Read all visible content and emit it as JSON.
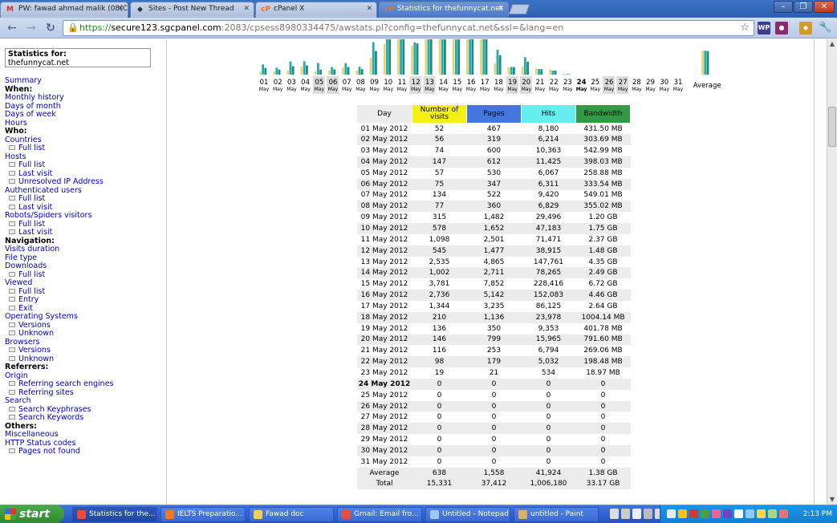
{
  "browser": {
    "tabs": [
      {
        "title": "PW: fawad ahmad malik (08(C",
        "icon": "gmail-icon",
        "color": "#d93025",
        "icon_text": "M"
      },
      {
        "title": "Sites - Post New Thread",
        "icon": "sites-icon",
        "color": "#333333",
        "icon_text": "◆"
      },
      {
        "title": "cPanel X",
        "icon": "cpanel-icon",
        "color": "#f26c1f",
        "icon_text": "cP"
      },
      {
        "title": "Statistics for thefunnycat.net",
        "icon": "cpanel-icon",
        "color": "#f26c1f",
        "icon_text": "cP",
        "active": true
      }
    ],
    "url": {
      "scheme": "https://",
      "host": "secure123.sgcpanel.com",
      "rest": ":2083/cpsess8980334475/awstats.pl?config=thefunnycat.net&ssl=&lang=en"
    },
    "accent": "#2f5fae"
  },
  "sidebar": {
    "stats_for_label": "Statistics for:",
    "site": "thefunnycat.net",
    "menu": [
      {
        "text": "Summary",
        "kind": "link"
      },
      {
        "text": "When:",
        "kind": "head"
      },
      {
        "text": "Monthly history",
        "kind": "link"
      },
      {
        "text": "Days of month",
        "kind": "link"
      },
      {
        "text": "Days of week",
        "kind": "link"
      },
      {
        "text": "Hours",
        "kind": "link"
      },
      {
        "text": "Who:",
        "kind": "head"
      },
      {
        "text": "Countries",
        "kind": "link"
      },
      {
        "text": "Full list",
        "kind": "sub"
      },
      {
        "text": "Hosts",
        "kind": "link"
      },
      {
        "text": "Full list",
        "kind": "sub"
      },
      {
        "text": "Last visit",
        "kind": "sub"
      },
      {
        "text": "Unresolved IP Address",
        "kind": "sub"
      },
      {
        "text": "Authenticated users",
        "kind": "link"
      },
      {
        "text": "Full list",
        "kind": "sub"
      },
      {
        "text": "Last visit",
        "kind": "sub"
      },
      {
        "text": "Robots/Spiders visitors",
        "kind": "link"
      },
      {
        "text": "Full list",
        "kind": "sub"
      },
      {
        "text": "Last visit",
        "kind": "sub"
      },
      {
        "text": "Navigation:",
        "kind": "head"
      },
      {
        "text": "Visits duration",
        "kind": "link"
      },
      {
        "text": "File type",
        "kind": "link"
      },
      {
        "text": "Downloads",
        "kind": "link"
      },
      {
        "text": "Full list",
        "kind": "sub"
      },
      {
        "text": "Viewed",
        "kind": "link"
      },
      {
        "text": "Full list",
        "kind": "sub"
      },
      {
        "text": "Entry",
        "kind": "sub"
      },
      {
        "text": "Exit",
        "kind": "sub"
      },
      {
        "text": "Operating Systems",
        "kind": "link"
      },
      {
        "text": "Versions",
        "kind": "sub"
      },
      {
        "text": "Unknown",
        "kind": "sub"
      },
      {
        "text": "Browsers",
        "kind": "link"
      },
      {
        "text": "Versions",
        "kind": "sub"
      },
      {
        "text": "Unknown",
        "kind": "sub"
      },
      {
        "text": "Referrers:",
        "kind": "head"
      },
      {
        "text": "Origin",
        "kind": "link"
      },
      {
        "text": "Referring search engines",
        "kind": "sub"
      },
      {
        "text": "Referring sites",
        "kind": "sub"
      },
      {
        "text": "Search",
        "kind": "link"
      },
      {
        "text": "Search Keyphrases",
        "kind": "sub"
      },
      {
        "text": "Search Keywords",
        "kind": "sub"
      },
      {
        "text": "Others:",
        "kind": "head"
      },
      {
        "text": "Miscellaneous",
        "kind": "link"
      },
      {
        "text": "HTTP Status codes",
        "kind": "link"
      },
      {
        "text": "Pages not found",
        "kind": "sub"
      }
    ]
  },
  "table": {
    "headers": {
      "day": "Day",
      "visits": "Number of visits",
      "pages": "Pages",
      "hits": "Hits",
      "bandwidth": "Bandwidth"
    },
    "header_colors": {
      "day": "#ececec",
      "visits": "#f5f116",
      "pages": "#4477dd",
      "hits": "#66eeee",
      "bandwidth": "#339944"
    },
    "rows": [
      [
        "01 May 2012",
        "52",
        "467",
        "8,180",
        "431.50 MB"
      ],
      [
        "02 May 2012",
        "56",
        "319",
        "6,214",
        "303.69 MB"
      ],
      [
        "03 May 2012",
        "74",
        "600",
        "10,363",
        "542.99 MB"
      ],
      [
        "04 May 2012",
        "147",
        "612",
        "11,425",
        "398.03 MB"
      ],
      [
        "05 May 2012",
        "57",
        "530",
        "6,067",
        "258.88 MB"
      ],
      [
        "06 May 2012",
        "75",
        "347",
        "6,311",
        "333.54 MB"
      ],
      [
        "07 May 2012",
        "134",
        "522",
        "9,420",
        "549.01 MB"
      ],
      [
        "08 May 2012",
        "77",
        "360",
        "6,829",
        "355.02 MB"
      ],
      [
        "09 May 2012",
        "315",
        "1,482",
        "29,496",
        "1.20 GB"
      ],
      [
        "10 May 2012",
        "578",
        "1,652",
        "47,183",
        "1.75 GB"
      ],
      [
        "11 May 2012",
        "1,098",
        "2,501",
        "71,471",
        "2.37 GB"
      ],
      [
        "12 May 2012",
        "545",
        "1,477",
        "38,915",
        "1.48 GB"
      ],
      [
        "13 May 2012",
        "2,535",
        "4,865",
        "147,761",
        "4.35 GB"
      ],
      [
        "14 May 2012",
        "1,002",
        "2,711",
        "78,265",
        "2.49 GB"
      ],
      [
        "15 May 2012",
        "3,781",
        "7,852",
        "228,416",
        "6.72 GB"
      ],
      [
        "16 May 2012",
        "2,736",
        "5,142",
        "152,083",
        "4.46 GB"
      ],
      [
        "17 May 2012",
        "1,344",
        "3,235",
        "86,125",
        "2.64 GB"
      ],
      [
        "18 May 2012",
        "210",
        "1,136",
        "23,978",
        "1004.14 MB"
      ],
      [
        "19 May 2012",
        "136",
        "350",
        "9,353",
        "401.78 MB"
      ],
      [
        "20 May 2012",
        "146",
        "799",
        "15,965",
        "791.60 MB"
      ],
      [
        "21 May 2012",
        "116",
        "253",
        "6,794",
        "269.06 MB"
      ],
      [
        "22 May 2012",
        "98",
        "179",
        "5,032",
        "198.48 MB"
      ],
      [
        "23 May 2012",
        "19",
        "21",
        "534",
        "18.97 MB"
      ],
      [
        "24 May 2012",
        "0",
        "0",
        "0",
        "0"
      ],
      [
        "25 May 2012",
        "0",
        "0",
        "0",
        "0"
      ],
      [
        "26 May 2012",
        "0",
        "0",
        "0",
        "0"
      ],
      [
        "27 May 2012",
        "0",
        "0",
        "0",
        "0"
      ],
      [
        "28 May 2012",
        "0",
        "0",
        "0",
        "0"
      ],
      [
        "29 May 2012",
        "0",
        "0",
        "0",
        "0"
      ],
      [
        "30 May 2012",
        "0",
        "0",
        "0",
        "0"
      ],
      [
        "31 May 2012",
        "0",
        "0",
        "0",
        "0"
      ]
    ],
    "current_day": "24 May 2012",
    "average": [
      "Average",
      "638",
      "1,558",
      "41,924",
      "1.38 GB"
    ],
    "total": [
      "Total",
      "15,331",
      "37,412",
      "1,006,180",
      "33.17 GB"
    ]
  },
  "chart_data": {
    "type": "bar",
    "categories": [
      "01",
      "02",
      "03",
      "04",
      "05",
      "06",
      "07",
      "08",
      "09",
      "10",
      "11",
      "12",
      "13",
      "14",
      "15",
      "16",
      "17",
      "18",
      "19",
      "20",
      "21",
      "22",
      "23",
      "24",
      "25",
      "26",
      "27",
      "28",
      "29",
      "30",
      "31"
    ],
    "month_label": "May",
    "weekend_days": [
      "05",
      "06",
      "12",
      "13",
      "19",
      "20",
      "26",
      "27"
    ],
    "current_day": "24",
    "average_label": "Average",
    "series": [
      {
        "name": "Number of visits",
        "color": "#e8d27a",
        "values": [
          52,
          56,
          74,
          147,
          57,
          75,
          134,
          77,
          315,
          578,
          1098,
          545,
          2535,
          1002,
          3781,
          2736,
          1344,
          210,
          136,
          146,
          116,
          98,
          19,
          0,
          0,
          0,
          0,
          0,
          0,
          0,
          0
        ],
        "average": 638
      },
      {
        "name": "Pages",
        "color": "#2aa9b0",
        "values": [
          467,
          319,
          600,
          612,
          530,
          347,
          522,
          360,
          1482,
          1652,
          2501,
          1477,
          4865,
          2711,
          7852,
          5142,
          3235,
          1136,
          350,
          799,
          253,
          179,
          21,
          0,
          0,
          0,
          0,
          0,
          0,
          0,
          0
        ],
        "average": 1558
      },
      {
        "name": "Hits",
        "color": "#1b8d7d",
        "values": [
          8180,
          6214,
          10363,
          11425,
          6067,
          6311,
          9420,
          6829,
          29496,
          47183,
          71471,
          38915,
          147761,
          78265,
          228416,
          152083,
          86125,
          23978,
          9353,
          15965,
          6794,
          5032,
          534,
          0,
          0,
          0,
          0,
          0,
          0,
          0,
          0
        ],
        "average": 41924
      }
    ],
    "scale_max": {
      "visits": 900,
      "pages": 2200,
      "hits": 60000
    }
  },
  "taskbar": {
    "start_label": "start",
    "tasks": [
      {
        "label": "Statistics for the...",
        "icon": "chrome-icon",
        "color": "#e94b3c",
        "active": true
      },
      {
        "label": "IELTS Preparatio...",
        "icon": "firefox-icon",
        "color": "#f0781e"
      },
      {
        "label": "Fawad doc",
        "icon": "folder-icon",
        "color": "#f2cf55"
      },
      {
        "label": "Gmail: Email fro...",
        "icon": "chrome-icon",
        "color": "#e94b3c"
      },
      {
        "label": "Untitled - Notepad",
        "icon": "notepad-icon",
        "color": "#9fc7f2"
      },
      {
        "label": "untitled - Paint",
        "icon": "paint-icon",
        "color": "#d9b26a"
      }
    ],
    "clock": "2:13 PM"
  }
}
